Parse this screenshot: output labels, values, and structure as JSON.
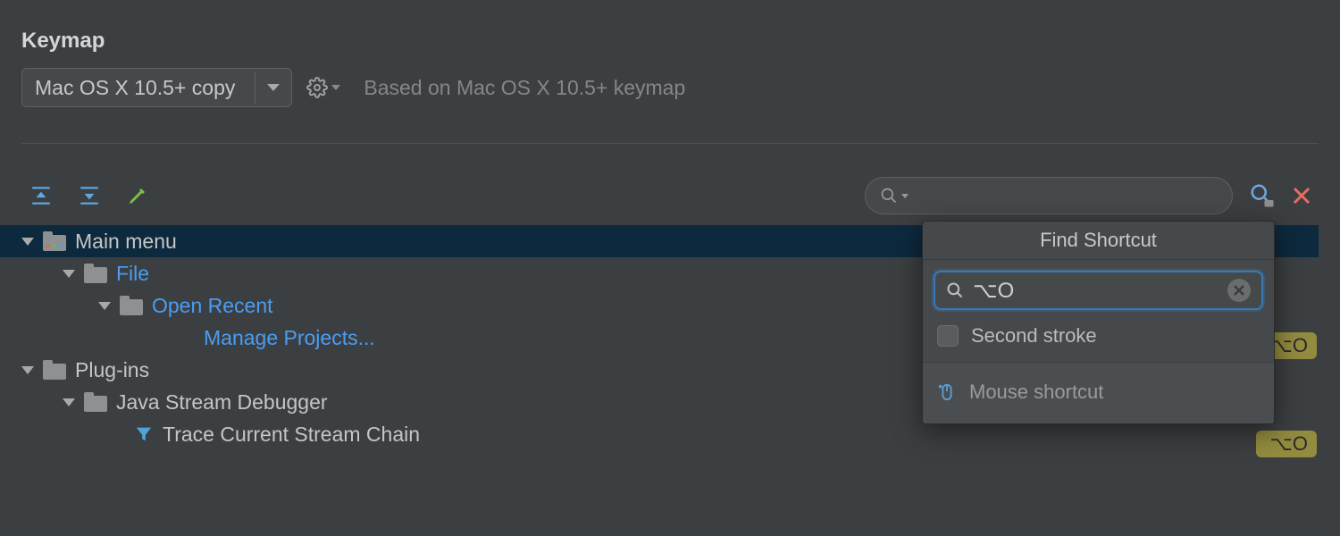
{
  "header": {
    "title": "Keymap",
    "dropdown_value": "Mac OS X 10.5+ copy",
    "based_on": "Based on Mac OS X 10.5+ keymap"
  },
  "search": {
    "placeholder": ""
  },
  "popup": {
    "title": "Find Shortcut",
    "input_value": "⌥O",
    "second_stroke_label": "Second stroke",
    "mouse_shortcut_label": "Mouse shortcut"
  },
  "tree": {
    "main_menu": "Main menu",
    "file": "File",
    "open_recent": "Open Recent",
    "manage_projects": "Manage Projects...",
    "plugins": "Plug-ins",
    "jsd": "Java Stream Debugger",
    "trace": "Trace Current Stream Chain"
  },
  "badges": {
    "shortcut": "⌥O"
  }
}
